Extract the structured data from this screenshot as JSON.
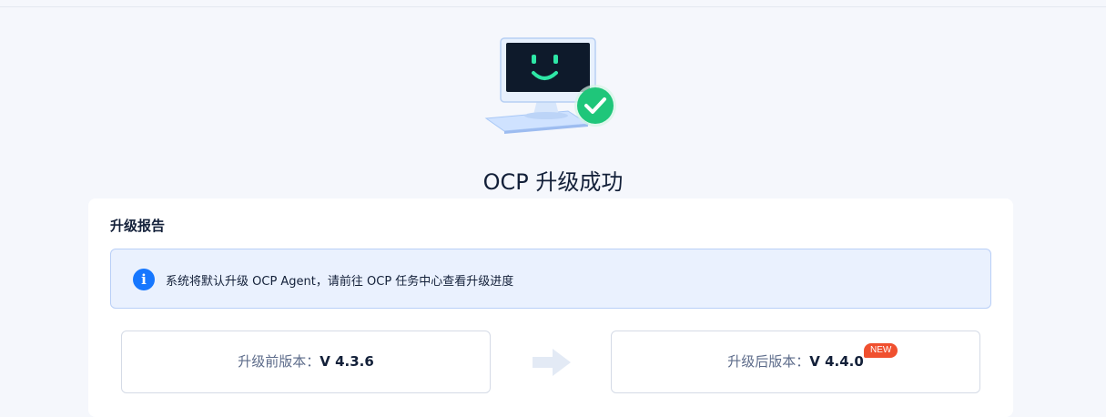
{
  "page": {
    "title": "OCP 升级成功"
  },
  "report": {
    "title": "升级报告",
    "notice": "系统将默认升级 OCP Agent，请前往 OCP 任务中心查看升级进度",
    "notice_icon": "info-icon",
    "before": {
      "label": "升级前版本：",
      "value": "V 4.3.6"
    },
    "after": {
      "label": "升级后版本：",
      "value": "V 4.4.0",
      "badge": "NEW"
    },
    "arrow_icon": "arrow-right-icon"
  },
  "colors": {
    "accent": "#1677ff",
    "success": "#1fc67a",
    "badge": "#f0502f",
    "background": "#f5f7fc"
  }
}
